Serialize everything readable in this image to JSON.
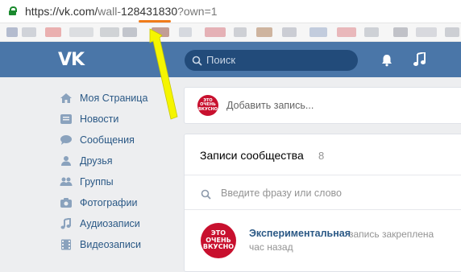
{
  "browser": {
    "url_prefix": "https://vk.com/",
    "url_wall": "wall-",
    "url_id": "128431830",
    "url_query": "?own=1"
  },
  "header": {
    "logo": "VK",
    "search_placeholder": "Поиск"
  },
  "sidebar": {
    "items": [
      {
        "label": "Моя Страница",
        "icon": "home-icon"
      },
      {
        "label": "Новости",
        "icon": "news-icon"
      },
      {
        "label": "Сообщения",
        "icon": "messages-icon"
      },
      {
        "label": "Друзья",
        "icon": "friends-icon"
      },
      {
        "label": "Группы",
        "icon": "groups-icon"
      },
      {
        "label": "Фотографии",
        "icon": "camera-icon"
      },
      {
        "label": "Аудиозаписи",
        "icon": "music-icon"
      },
      {
        "label": "Видеозаписи",
        "icon": "video-icon"
      }
    ]
  },
  "composer": {
    "placeholder": "Добавить запись...",
    "avatar_text": "ЭТО ОЧЕНЬ ВКУСНО"
  },
  "wall": {
    "title": "Записи сообщества",
    "count": "8",
    "search_placeholder": "Введите фразу или слово"
  },
  "post": {
    "author": "Экспериментальная",
    "status": "запись закреплена",
    "time": "час назад",
    "avatar_text": "ЭТО ОЧЕНЬ ВКУСНО"
  },
  "colors": {
    "vk_blue": "#4a76a8",
    "link": "#2a5885",
    "highlight_underline": "#f07b1a",
    "arrow": "#f5f500",
    "brand_red": "#c8102e"
  }
}
